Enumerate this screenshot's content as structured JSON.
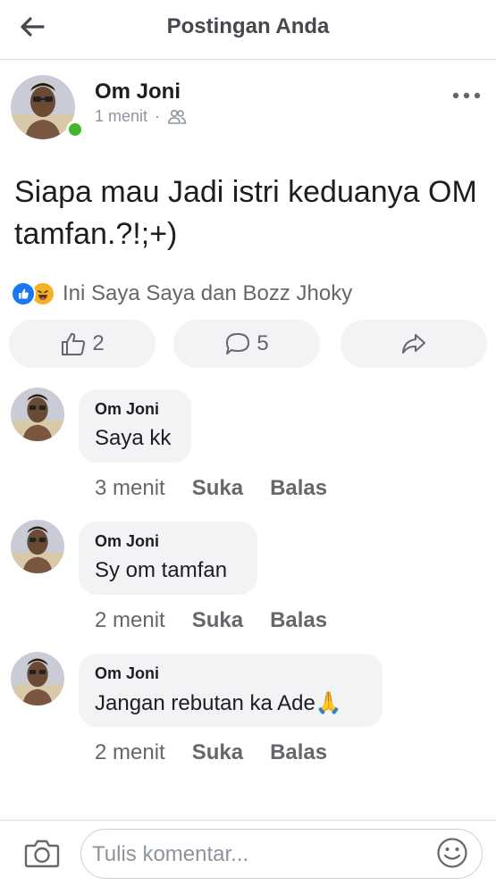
{
  "header": {
    "title": "Postingan Anda"
  },
  "post": {
    "author": "Om Joni",
    "time": "1 menit",
    "separator": "·",
    "text": "Siapa mau Jadi istri keduanya OM tamfan.?!;+)",
    "reactions_text": "Ini Saya Saya dan Bozz Jhoky",
    "like_count": "2",
    "comment_count": "5"
  },
  "comments": [
    {
      "name": "Om Joni",
      "text": "Saya kk",
      "time": "3 menit",
      "like_label": "Suka",
      "reply_label": "Balas"
    },
    {
      "name": "Om Joni",
      "text": "Sy om tamfan",
      "time": "2 menit",
      "like_label": "Suka",
      "reply_label": "Balas"
    },
    {
      "name": "Om Joni",
      "text": "Jangan rebutan ka Ade",
      "emoji": "🙏",
      "time": "2 menit",
      "like_label": "Suka",
      "reply_label": "Balas"
    }
  ],
  "composer": {
    "placeholder": "Tulis komentar..."
  },
  "colors": {
    "online": "#42b72a",
    "like_blue": "#1877f2",
    "haha_yellow": "#f7b125",
    "muted": "#65676b"
  }
}
